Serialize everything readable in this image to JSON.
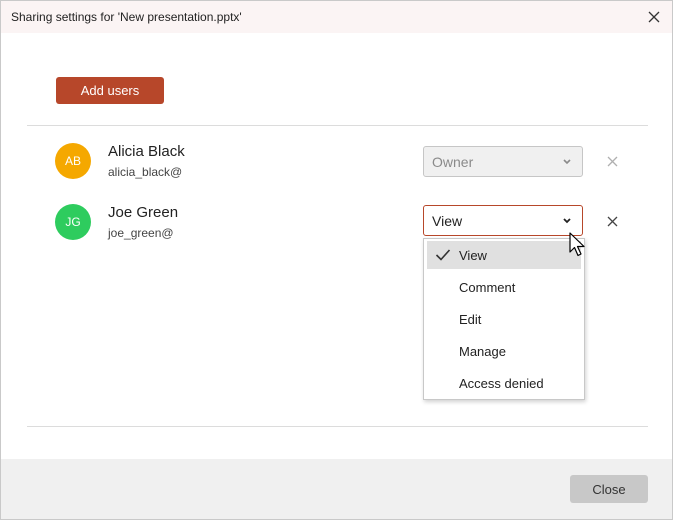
{
  "dialog": {
    "title": "Sharing settings for 'New presentation.pptx'",
    "close_icon": "close-icon"
  },
  "toolbar": {
    "add_users_label": "Add users"
  },
  "users": [
    {
      "initials": "AB",
      "name": "Alicia Black",
      "email": "alicia_black@",
      "avatar_color": "#f5a800",
      "permission": "Owner",
      "editable": false
    },
    {
      "initials": "JG",
      "name": "Joe Green",
      "email": "joe_green@",
      "avatar_color": "#2ecc5e",
      "permission": "View",
      "editable": true
    }
  ],
  "permission_dropdown": {
    "selected": "View",
    "options": [
      {
        "label": "View"
      },
      {
        "label": "Comment"
      },
      {
        "label": "Edit"
      },
      {
        "label": "Manage"
      },
      {
        "label": "Access denied"
      }
    ]
  },
  "footer": {
    "close_label": "Close"
  },
  "colors": {
    "accent": "#b7472a",
    "title_bar_bg": "#fbf4f4",
    "footer_bg": "#f0f0f0"
  }
}
